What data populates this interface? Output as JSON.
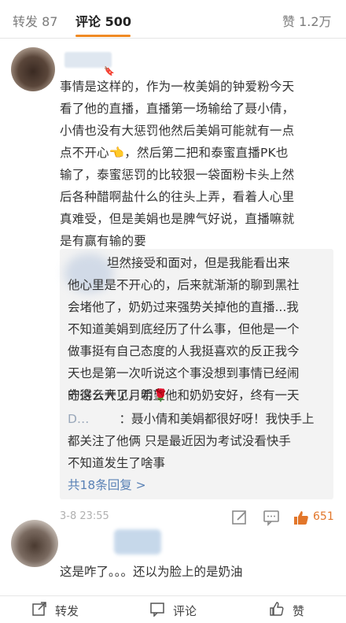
{
  "tabs": {
    "repost": "转发 87",
    "comments": "评论 500",
    "likes": "赞 1.2万"
  },
  "comment1": {
    "badge": "🔖",
    "lines": [
      "事情是这样的，作为一枚美娟的钟爱粉今天",
      "看了他的直播，直播第一场输给了聂小倩，",
      "小倩也没有大惩罚他然后美娟可能就有一点",
      "点不开心👈，然后第二把和泰蜜直播PK也",
      "输了，泰蜜惩罚的比较狠一袋面粉卡头上然",
      "后各种醋啊盐什么的往头上弄，看着人心里",
      "真难受，但是美娟也是脾气好说，直播嘛就",
      "是有赢有输的要"
    ],
    "reply1_lines": [
      "坦然接受和面对，但是我能看出来",
      "他心里是不开心的，后来就渐渐的聊到黑社",
      "会堵他了，奶奶过来强势关掉他的直播...我",
      "不知道美娟到底经历了什么事，但他是一个",
      "做事挺有自己态度的人我挺喜欢的反正我今",
      "天也是第一次听说这个事没想到事情已经闹",
      "的这么大了，希望他和奶奶安好，终有一天",
      "守得云开见月明🌹"
    ],
    "reply2_prefix": "D…",
    "reply2_lines": [
      "：聂小倩和美娟都很好呀！我快手上",
      "都关注了他俩 只是最近因为考试没看快手",
      "不知道发生了啥事"
    ],
    "more_replies": "共18条回复 >",
    "timestamp": "3-8 23:55",
    "like_count": "651"
  },
  "comment2": {
    "text": "这是咋了。。。还以为脸上的是奶油"
  },
  "bottom_bar": {
    "repost": "转发",
    "comment": "评论",
    "like": "赞"
  },
  "colors": {
    "accent": "#f08a24",
    "link": "#5a82b6",
    "like": "#e2762a"
  }
}
